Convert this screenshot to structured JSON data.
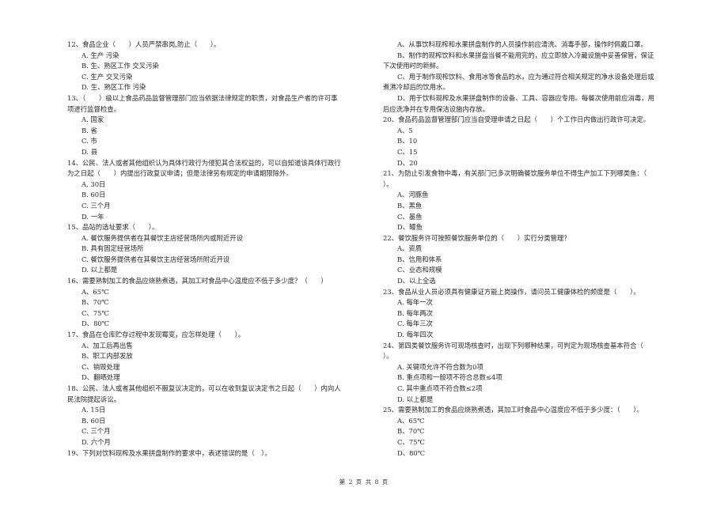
{
  "page": {
    "footer": "第 2 页 共 8 页"
  },
  "left_column": [
    {
      "type": "q",
      "text": "12、食品企业（　　）人员严禁串岗,防止（　　）。"
    },
    {
      "type": "opt",
      "text": "A. 生产 污染"
    },
    {
      "type": "opt",
      "text": "B. 生、熟区工作 交叉污染"
    },
    {
      "type": "opt",
      "text": "C. 生产 交叉污染"
    },
    {
      "type": "opt",
      "text": "D. 生、熟区工作 污染"
    },
    {
      "type": "q",
      "text": "13、（　　）级以上食品药品监督管理部门应当依据法律规定的职责，对食品生产者的许可事"
    },
    {
      "type": "q",
      "text": "项进行监督检查。"
    },
    {
      "type": "opt",
      "text": "A. 国家"
    },
    {
      "type": "opt",
      "text": "B. 省"
    },
    {
      "type": "opt",
      "text": "C. 市"
    },
    {
      "type": "opt",
      "text": "D. 县"
    },
    {
      "type": "q",
      "text": "14、公民、法人或者其他组织认为具体行政行为侵犯其合法权益的，可以自知道该具体行政行"
    },
    {
      "type": "q",
      "text": "为之日起（　　）内提出行政复议申请；但是法律另有规定的申请期限除外。"
    },
    {
      "type": "opt",
      "text": "A. 30日"
    },
    {
      "type": "opt",
      "text": "B. 60日"
    },
    {
      "type": "opt",
      "text": "C. 三个月"
    },
    {
      "type": "opt",
      "text": "D. 一年"
    },
    {
      "type": "q",
      "text": "15、品站的选址要求（　　）。"
    },
    {
      "type": "opt",
      "text": "A. 餐饮服务提供者在其餐饮主店经营场所内或附近开设"
    },
    {
      "type": "opt",
      "text": "B. 具有固定经营场所"
    },
    {
      "type": "opt",
      "text": "C. 餐饮服务提供者在其餐饮主店经营场所附近开设"
    },
    {
      "type": "opt",
      "text": "D. 以上都是"
    },
    {
      "type": "q",
      "text": "16、需要熟制加工的食品应烧熟煮透，其加工时食品中心温度应不低于多少度？（　　）"
    },
    {
      "type": "opt",
      "text": "A、65℃"
    },
    {
      "type": "opt",
      "text": "B、70℃"
    },
    {
      "type": "opt",
      "text": "C、75℃"
    },
    {
      "type": "opt",
      "text": "D、80℃"
    },
    {
      "type": "q",
      "text": "17、食品在仓库贮存过程中发现霉变，应怎样处理（　　）。"
    },
    {
      "type": "opt",
      "text": "A、加工后再出售"
    },
    {
      "type": "opt",
      "text": "B、职工内部发放"
    },
    {
      "type": "opt",
      "text": "C、销毁处理"
    },
    {
      "type": "opt",
      "text": "D、翻晒处理"
    },
    {
      "type": "q",
      "text": "18、公民、法人或者其他组织不服复议决定的，可以在收到复议决定书之日起（　　）内向人"
    },
    {
      "type": "q",
      "text": "民法院提起诉讼。"
    },
    {
      "type": "opt",
      "text": "A. 15日"
    },
    {
      "type": "opt",
      "text": "B. 60日"
    },
    {
      "type": "opt",
      "text": "C. 三个月"
    },
    {
      "type": "opt",
      "text": "D. 六个月"
    },
    {
      "type": "q",
      "text": "19、下列对饮料现榨及水果拼盘制作的要求中，表述错误的是（　）。"
    }
  ],
  "right_column": [
    {
      "type": "indent",
      "text": "A、从事饮料现榨和水果拼盘制作的人员操作前应清洗、消毒手部，操作时佩戴口罩。"
    },
    {
      "type": "indent",
      "text": "B、制作的现榨饮料和水果拼盘当餐不能用完的，应立即放入冷藏设施中妥善保管，保证"
    },
    {
      "type": "q",
      "text": "下次使用时的新鲜。"
    },
    {
      "type": "indent",
      "text": "C、用于制作现榨饮料、食用冰等食品的水，应为通过符合相关规定的净水设备处理后或"
    },
    {
      "type": "q",
      "text": "煮沸冷却后的饮用水。"
    },
    {
      "type": "indent",
      "text": "D、用于饮料现榨及水果拼盘制作的设备、工具、容器应专用。每餐次使用前应消毒，用"
    },
    {
      "type": "q",
      "text": "后应洗净并在专用保洁设施内存放。"
    },
    {
      "type": "q",
      "text": "20、食品药品监督管理部门应当自受理申请之日起（　　）个工作日内做出行政许可决定。"
    },
    {
      "type": "opt",
      "text": "A、5"
    },
    {
      "type": "opt",
      "text": "B、10"
    },
    {
      "type": "opt",
      "text": "C、15"
    },
    {
      "type": "opt",
      "text": "D、20"
    },
    {
      "type": "q",
      "text": "21、为防止引发食物中毒，有关部门已多次明确餐饮服务单位不得生产加工下列哪类鱼：（"
    },
    {
      "type": "q",
      "text": "）。"
    },
    {
      "type": "opt",
      "text": "A、河豚鱼"
    },
    {
      "type": "opt",
      "text": "B、黑鱼"
    },
    {
      "type": "opt",
      "text": "C、墨鱼"
    },
    {
      "type": "opt",
      "text": "D、鳗鱼"
    },
    {
      "type": "q",
      "text": "22、餐饮服务许可按照餐饮服务单位的（　　）实行分类管理？"
    },
    {
      "type": "opt",
      "text": "A、资质"
    },
    {
      "type": "opt",
      "text": "B、信用和体系"
    },
    {
      "type": "opt",
      "text": "C、业态和规模"
    },
    {
      "type": "opt",
      "text": "D、以上全选"
    },
    {
      "type": "q",
      "text": "23、食品从业人员必须具有健康证方能上岗操作，请问员工健康体检的频度是（　　）。"
    },
    {
      "type": "opt",
      "text": "A. 每年一次"
    },
    {
      "type": "opt",
      "text": "B. 每年两次"
    },
    {
      "type": "opt",
      "text": "C. 每年三次"
    },
    {
      "type": "opt",
      "text": "D. 每年四次"
    },
    {
      "type": "q",
      "text": "24、第四类餐饮服务许可现场核查时，出现下列哪种结果，可判定为现场核查基本符合（"
    },
    {
      "type": "q",
      "text": "）。"
    },
    {
      "type": "opt",
      "text": "A. 关键项允许不符合数为0项"
    },
    {
      "type": "opt",
      "text": "B. 重点项和一般项不符合总数≤4项"
    },
    {
      "type": "opt",
      "text": "C. 其中重点项不符合数≤2项"
    },
    {
      "type": "opt",
      "text": "D. 以上都是"
    },
    {
      "type": "q",
      "text": "25、需要熟制加工的食品应烧熟煮透，其加工时食品中心温度应不低于多少度：（　　）。"
    },
    {
      "type": "opt",
      "text": "A、65℃"
    },
    {
      "type": "opt",
      "text": "B、70℃"
    },
    {
      "type": "opt",
      "text": "C、75℃"
    },
    {
      "type": "opt",
      "text": "D、80℃"
    }
  ]
}
